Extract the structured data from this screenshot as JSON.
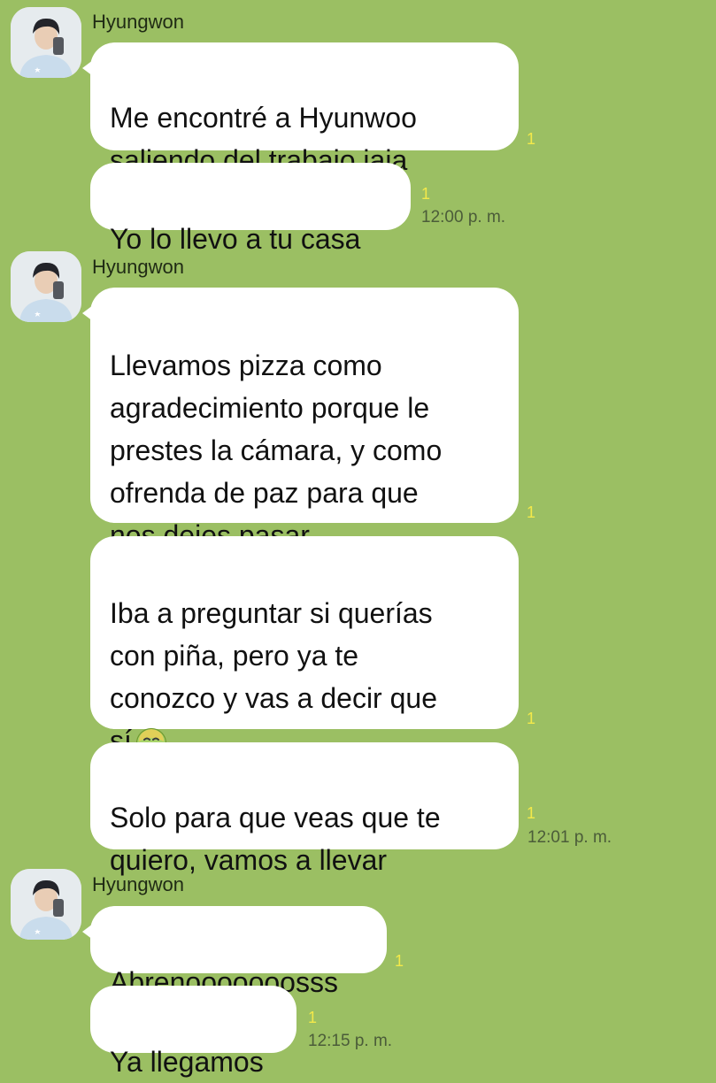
{
  "chat": {
    "accent": "#9bbf63",
    "read_color": "#f3e94a",
    "groups": [
      {
        "sender": "Hyungwon",
        "avatar_icon": "profile-photo-icon",
        "messages": [
          {
            "text": "Me encontré a Hyunwoo\nsaliendo del trabajo jaja",
            "read": "1"
          },
          {
            "text": "Yo lo llevo a tu casa",
            "read": "1",
            "time": "12:00 p. m."
          }
        ]
      },
      {
        "sender": "Hyungwon",
        "avatar_icon": "profile-photo-icon",
        "messages": [
          {
            "text": "Llevamos pizza como\nagradecimiento porque le\nprestes la cámara, y como\nofrenda de paz para que\nnos dejes pasar",
            "read": "1"
          },
          {
            "text": "Iba a preguntar si querías\ncon piña, pero ya te\nconozco y vas a decir que\nsí",
            "emoji": "nauseated-face-icon",
            "read": "1"
          },
          {
            "text": "Solo para que veas que te\nquiero, vamos a llevar",
            "read": "1",
            "time": "12:01 p. m."
          }
        ]
      },
      {
        "sender": "Hyungwon",
        "avatar_icon": "profile-photo-icon",
        "messages": [
          {
            "text": "Abrenooooooosss",
            "read": "1"
          },
          {
            "text": "Ya llegamos",
            "read": "1",
            "time": "12:15 p. m."
          }
        ]
      }
    ]
  }
}
